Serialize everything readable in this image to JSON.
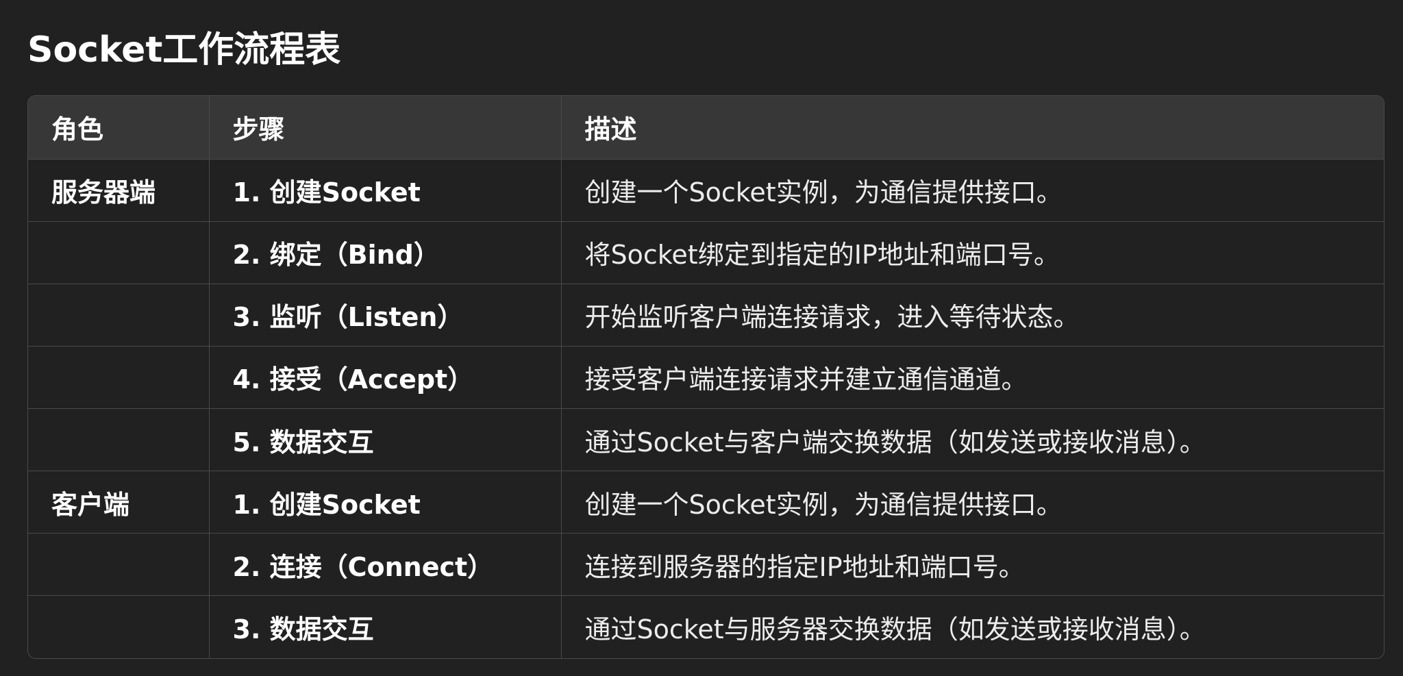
{
  "title": "Socket工作流程表",
  "table": {
    "headers": [
      "角色",
      "步骤",
      "描述"
    ],
    "rows": [
      {
        "role": "服务器端",
        "step": "1. 创建Socket",
        "desc": "创建一个Socket实例，为通信提供接口。"
      },
      {
        "role": "",
        "step": "2. 绑定（Bind）",
        "desc": "将Socket绑定到指定的IP地址和端口号。"
      },
      {
        "role": "",
        "step": "3. 监听（Listen）",
        "desc": "开始监听客户端连接请求，进入等待状态。"
      },
      {
        "role": "",
        "step": "4. 接受（Accept）",
        "desc": "接受客户端连接请求并建立通信通道。"
      },
      {
        "role": "",
        "step": "5. 数据交互",
        "desc": "通过Socket与客户端交换数据（如发送或接收消息）。"
      },
      {
        "role": "客户端",
        "step": "1. 创建Socket",
        "desc": "创建一个Socket实例，为通信提供接口。"
      },
      {
        "role": "",
        "step": "2. 连接（Connect）",
        "desc": "连接到服务器的指定IP地址和端口号。"
      },
      {
        "role": "",
        "step": "3. 数据交互",
        "desc": "通过Socket与服务器交换数据（如发送或接收消息）。"
      }
    ]
  }
}
